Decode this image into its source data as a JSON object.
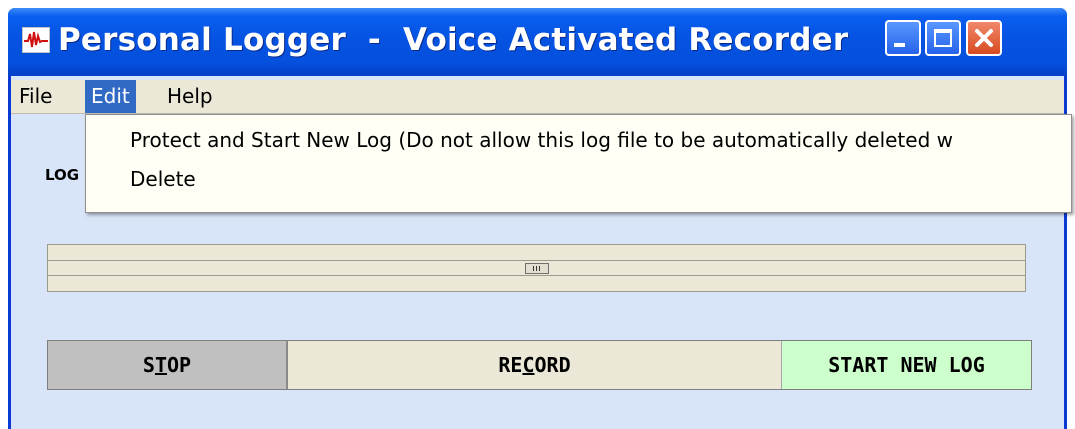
{
  "window": {
    "title": "Personal Logger  -  Voice Activated Recorder",
    "controls": [
      "minimize",
      "maximize",
      "close"
    ],
    "icon": "waveform-icon"
  },
  "menubar": {
    "items": [
      {
        "label": "File",
        "active": false
      },
      {
        "label": "Edit",
        "active": true
      },
      {
        "label": "Help",
        "active": false
      }
    ]
  },
  "edit_menu": {
    "items": [
      "Protect and Start New Log  (Do not allow this log file to be automatically deleted w",
      "Delete"
    ]
  },
  "log_label": "LOG",
  "slider": {
    "value_fraction": 0.5
  },
  "buttons": {
    "stop": {
      "pre": "S",
      "mnemonic": "T",
      "post": "OP"
    },
    "record": {
      "pre": "RE",
      "mnemonic": "C",
      "post": "ORD"
    },
    "start_new_log": "START NEW LOG"
  },
  "colors": {
    "titlebar": "#0553e2",
    "menu_highlight": "#316ac5",
    "client_bg": "#d8e4f7",
    "stop_bg": "#c0c0c0",
    "start_new_log_bg": "#ccffcc"
  }
}
